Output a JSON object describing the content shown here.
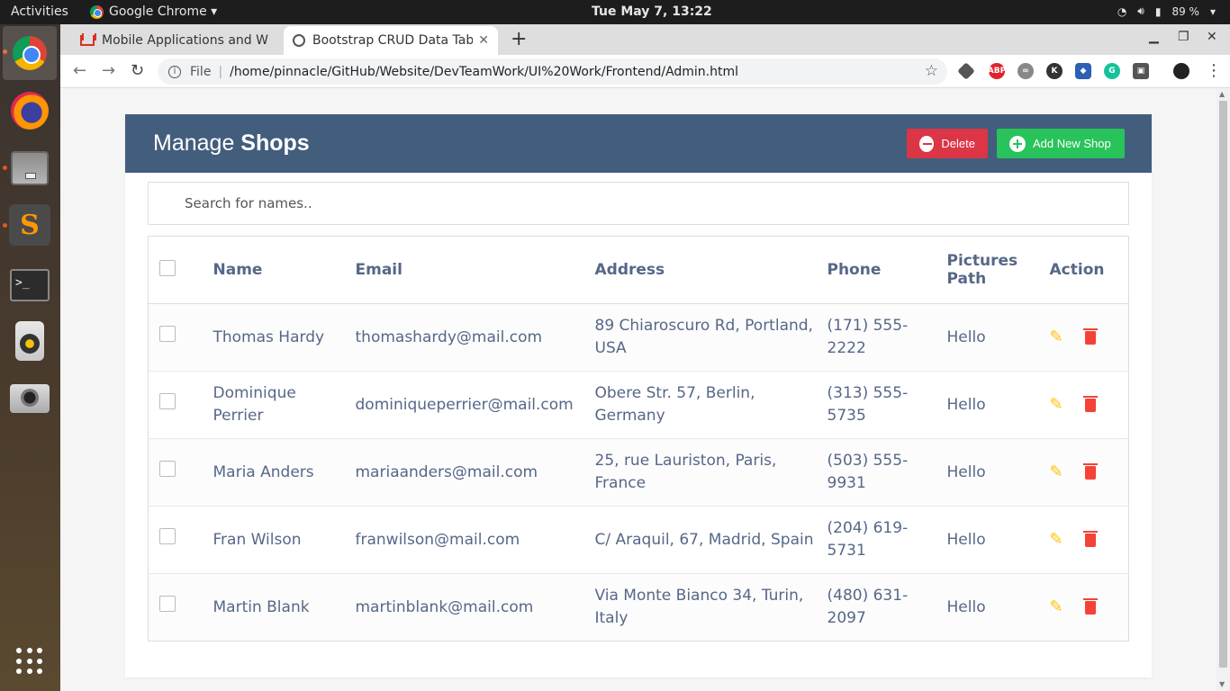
{
  "system": {
    "activities": "Activities",
    "app_name": "Google Chrome ▾",
    "clock": "Tue May  7, 13:22",
    "battery": "89 %"
  },
  "browser": {
    "tabs": [
      {
        "title": "Mobile Applications and W"
      },
      {
        "title": "Bootstrap CRUD Data Tab"
      }
    ],
    "url_scheme_label": "File",
    "url": "/home/pinnacle/GitHub/Website/DevTeamWork/UI%20Work/Frontend/Admin.html"
  },
  "page": {
    "title_light": "Manage ",
    "title_bold": "Shops",
    "delete_label": "Delete",
    "add_label": "Add New Shop",
    "search_placeholder": "Search for names..",
    "columns": [
      "Name",
      "Email",
      "Address",
      "Phone",
      "Pictures Path",
      "Action"
    ],
    "rows": [
      {
        "name": "Thomas Hardy",
        "email": "thomashardy@mail.com",
        "address": "89 Chiaroscuro Rd, Portland, USA",
        "phone": "(171) 555-2222",
        "pictures_path": "Hello"
      },
      {
        "name": "Dominique Perrier",
        "email": "dominiqueperrier@mail.com",
        "address": "Obere Str. 57, Berlin, Germany",
        "phone": "(313) 555-5735",
        "pictures_path": "Hello"
      },
      {
        "name": "Maria Anders",
        "email": "mariaanders@mail.com",
        "address": "25, rue Lauriston, Paris, France",
        "phone": "(503) 555-9931",
        "pictures_path": "Hello"
      },
      {
        "name": "Fran Wilson",
        "email": "franwilson@mail.com",
        "address": "C/ Araquil, 67, Madrid, Spain",
        "phone": "(204) 619-5731",
        "pictures_path": "Hello"
      },
      {
        "name": "Martin Blank",
        "email": "martinblank@mail.com",
        "address": "Via Monte Bianco 34, Turin, Italy",
        "phone": "(480) 631-2097",
        "pictures_path": "Hello"
      }
    ]
  },
  "colors": {
    "header": "#435d7d",
    "delete": "#dc3545",
    "add": "#28c35a",
    "edit_icon": "#ffc107",
    "trash_icon": "#f44336"
  }
}
